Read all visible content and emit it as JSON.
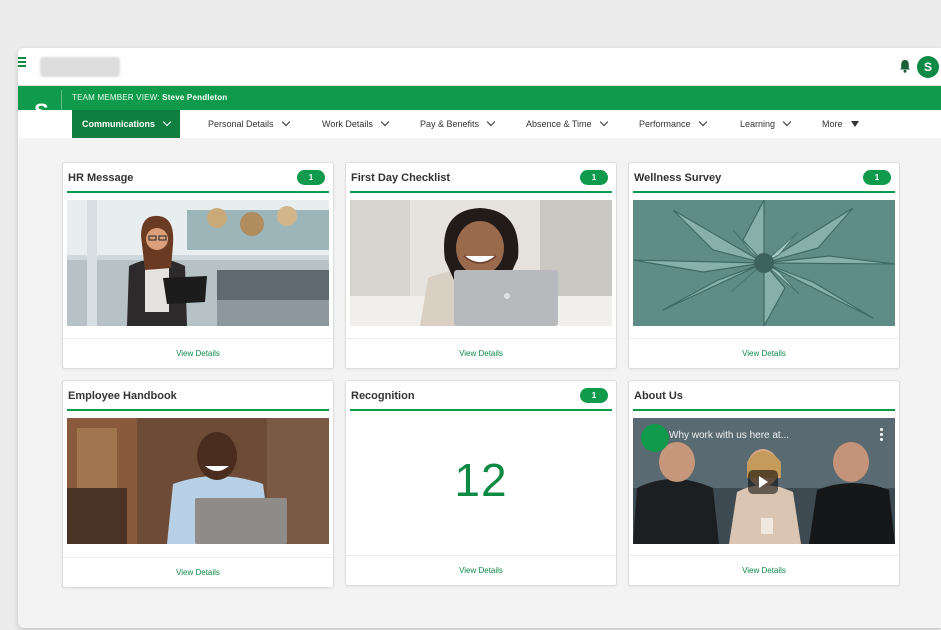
{
  "header": {
    "avatar_initial": "S",
    "bell_icon": "bell-icon",
    "logo": "S",
    "team_label_prefix": "TEAM MEMBER VIEW:",
    "team_member_name": "Steve Pendleton"
  },
  "nav": {
    "items": [
      {
        "label": "Communications",
        "icon": "chevron-down-icon"
      },
      {
        "label": "Personal Details",
        "icon": "chevron-down-icon"
      },
      {
        "label": "Work Details",
        "icon": "chevron-down-icon"
      },
      {
        "label": "Pay & Benefits",
        "icon": "chevron-down-icon"
      },
      {
        "label": "Absence & Time",
        "icon": "chevron-down-icon"
      },
      {
        "label": "Performance",
        "icon": "chevron-down-icon"
      },
      {
        "label": "Learning",
        "icon": "chevron-down-icon"
      },
      {
        "label": "More",
        "icon": "caret-down-icon"
      }
    ]
  },
  "cards": [
    {
      "title": "HR Message",
      "badge": "1",
      "link": "View Details"
    },
    {
      "title": "First Day Checklist",
      "badge": "1",
      "link": "View Details"
    },
    {
      "title": "Wellness Survey",
      "badge": "1",
      "link": "View Details"
    },
    {
      "title": "Employee Handbook",
      "badge": "",
      "link": "View Details"
    },
    {
      "title": "Recognition",
      "badge": "1",
      "link": "View Details",
      "value": "12"
    },
    {
      "title": "About Us",
      "badge": "",
      "link": "View Details",
      "video_title": "Why work with us here at..."
    }
  ],
  "colors": {
    "brand_green": "#0f9a4c",
    "brand_green_dark": "#0f7e3f",
    "text_dark": "#333333"
  }
}
